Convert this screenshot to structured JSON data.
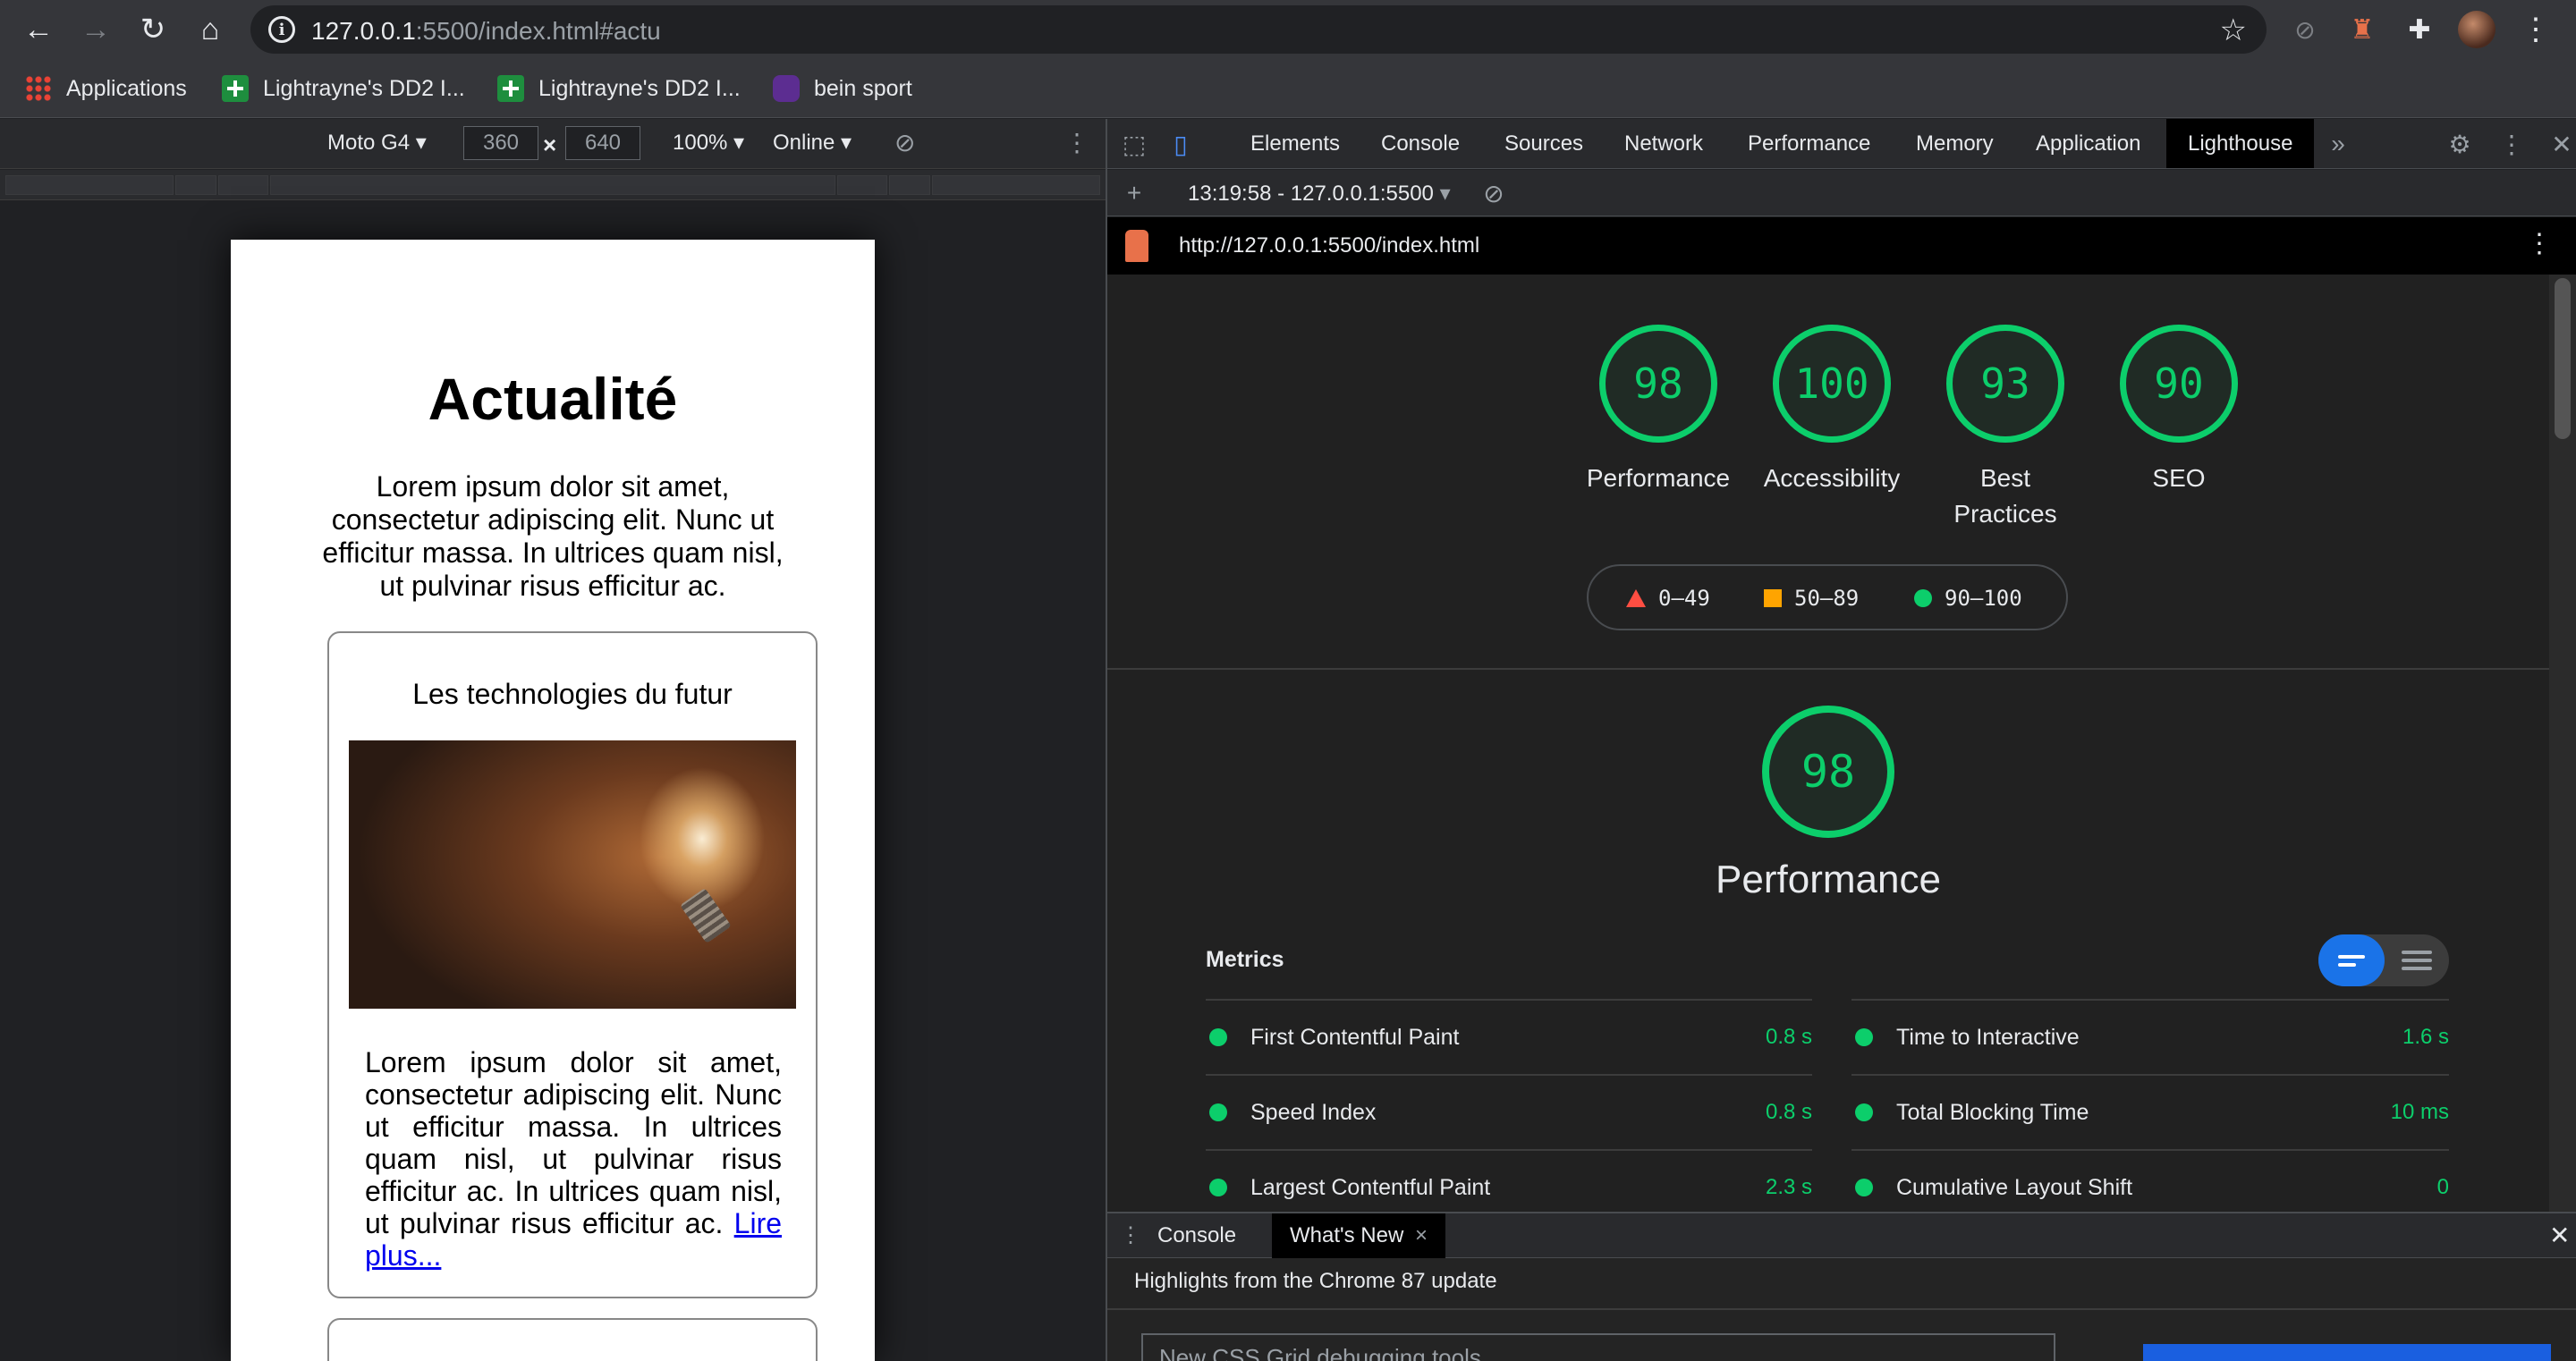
{
  "browser": {
    "url_host": "127.0.0.1",
    "url_rest": ":5500/index.html#actu",
    "bookmarks": [
      "Applications",
      "Lightrayne's DD2 I...",
      "Lightrayne's DD2 I...",
      "bein sport"
    ]
  },
  "device_toolbar": {
    "device": "Moto G4",
    "width": "360",
    "height": "640",
    "times": "×",
    "zoom": "100%",
    "network": "Online"
  },
  "page": {
    "title": "Actualité",
    "intro": "Lorem ipsum dolor sit amet, consectetur adipiscing elit. Nunc ut efficitur massa. In ultrices quam nisl, ut pulvinar risus efficitur ac.",
    "card_title": "Les technologies du futur",
    "card_text": "Lorem ipsum dolor sit amet, consectetur adipiscing elit. Nunc ut efficitur massa. In ultrices quam nisl, ut pulvinar risus efficitur ac. In ultrices quam nisl, ut pulvinar risus efficitur ac.",
    "card_link": "Lire plus..."
  },
  "devtools": {
    "tabs": [
      "Elements",
      "Console",
      "Sources",
      "Network",
      "Performance",
      "Memory",
      "Application",
      "Lighthouse"
    ],
    "active_tab": "Lighthouse",
    "report_select": "13:19:58 - 127.0.0.1:5500",
    "report_url": "http://127.0.0.1:5500/index.html"
  },
  "lighthouse": {
    "scores": [
      {
        "label": "Performance",
        "value": "98"
      },
      {
        "label": "Accessibility",
        "value": "100"
      },
      {
        "label": "Best Practices",
        "value": "93"
      },
      {
        "label": "SEO",
        "value": "90"
      }
    ],
    "legend": [
      "0–49",
      "50–89",
      "90–100"
    ],
    "legend_colors": {
      "fail": "#ff4e42",
      "average": "#ffa400",
      "pass": "#0cce6b"
    },
    "perf_score": "98",
    "perf_title": "Performance",
    "metrics_heading": "Metrics",
    "metrics_left": [
      {
        "name": "First Contentful Paint",
        "value": "0.8 s"
      },
      {
        "name": "Speed Index",
        "value": "0.8 s"
      },
      {
        "name": "Largest Contentful Paint",
        "value": "2.3 s"
      }
    ],
    "metrics_right": [
      {
        "name": "Time to Interactive",
        "value": "1.6 s"
      },
      {
        "name": "Total Blocking Time",
        "value": "10 ms"
      },
      {
        "name": "Cumulative Layout Shift",
        "value": "0"
      }
    ]
  },
  "drawer": {
    "tabs": [
      "Console",
      "What's New"
    ],
    "active_tab": "What's New",
    "highlights": "Highlights from the Chrome 87 update",
    "card_title": "New CSS Grid debugging tools"
  }
}
